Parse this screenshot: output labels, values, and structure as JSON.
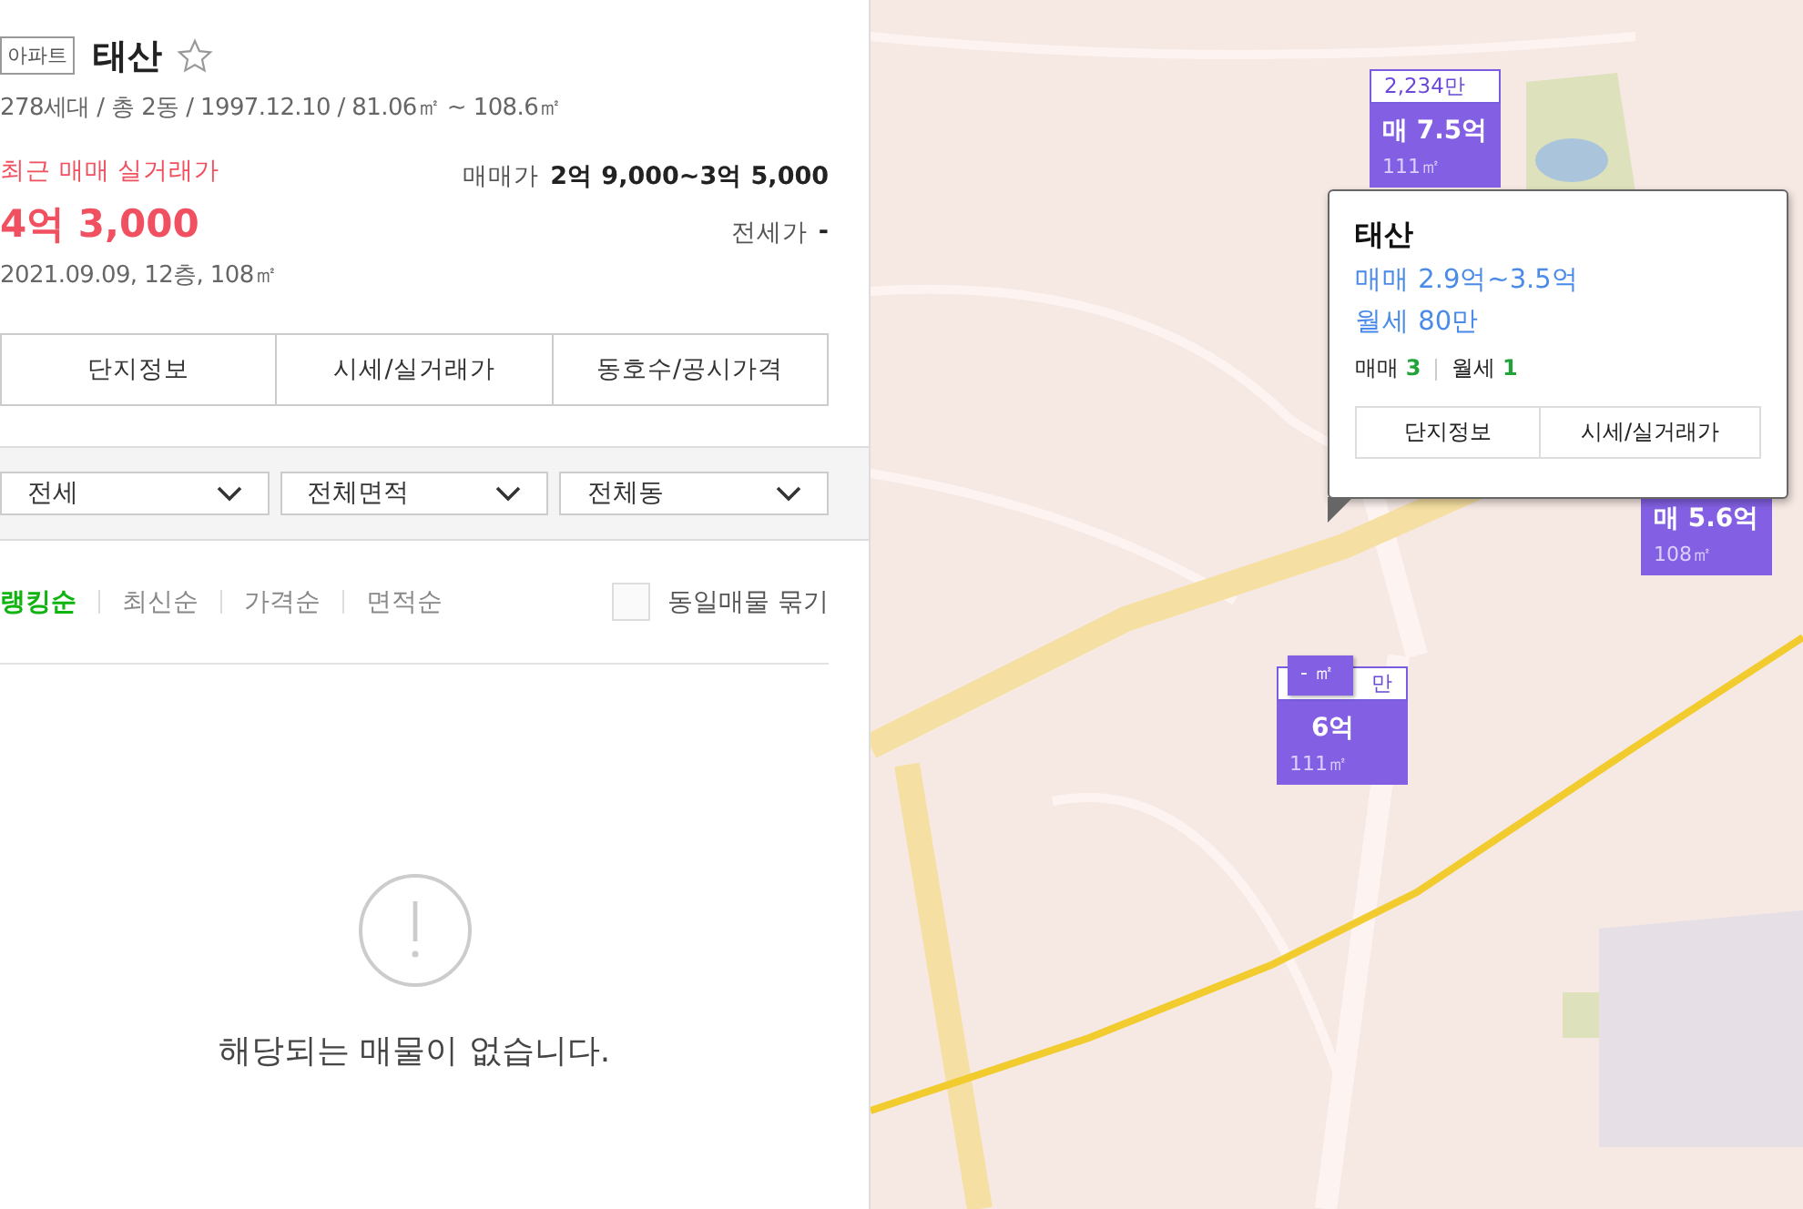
{
  "complex": {
    "type_badge": "아파트",
    "name": "태산",
    "favorite": false,
    "summary": "278세대 / 총 2동 / 1997.12.10 / 81.06㎡ ~ 108.6㎡"
  },
  "recent_trade": {
    "label": "최근 매매 실거래가",
    "price": "4억 3,000",
    "detail": "2021.09.09, 12층, 108㎡"
  },
  "price_ranges": [
    {
      "label": "매매가",
      "value": "2억 9,000~3억 5,000"
    },
    {
      "label": "전세가",
      "value": "-"
    }
  ],
  "info_buttons": [
    "단지정보",
    "시세/실거래가",
    "동호수/공시가격"
  ],
  "filters": [
    {
      "value": "전세"
    },
    {
      "value": "전체면적"
    },
    {
      "value": "전체동"
    }
  ],
  "sort_options": [
    {
      "label": "랭킹순",
      "selected": true
    },
    {
      "label": "최신순",
      "selected": false
    },
    {
      "label": "가격순",
      "selected": false
    },
    {
      "label": "면적순",
      "selected": false
    }
  ],
  "group_same_listings": {
    "label": "동일매물 묶기",
    "checked": false
  },
  "empty_state": {
    "message": "해당되는 매물이 없습니다."
  },
  "map": {
    "markers": [
      {
        "kind": "full",
        "top_label": "2,234만",
        "price": "매 7.5억",
        "area": "111㎡"
      },
      {
        "kind": "full",
        "price": "매 5.6억",
        "area": "108㎡"
      },
      {
        "kind": "full",
        "top_label": "만",
        "price": "6억",
        "area": "111㎡"
      },
      {
        "kind": "tag",
        "label": "- ㎡"
      }
    ],
    "popup": {
      "name": "태산",
      "lines": [
        "매매 2.9억~3.5억",
        "월세 80만"
      ],
      "counts": [
        {
          "label": "매매",
          "count": "3"
        },
        {
          "label": "월세",
          "count": "1"
        }
      ],
      "buttons": [
        "단지정보",
        "시세/실거래가"
      ]
    }
  }
}
